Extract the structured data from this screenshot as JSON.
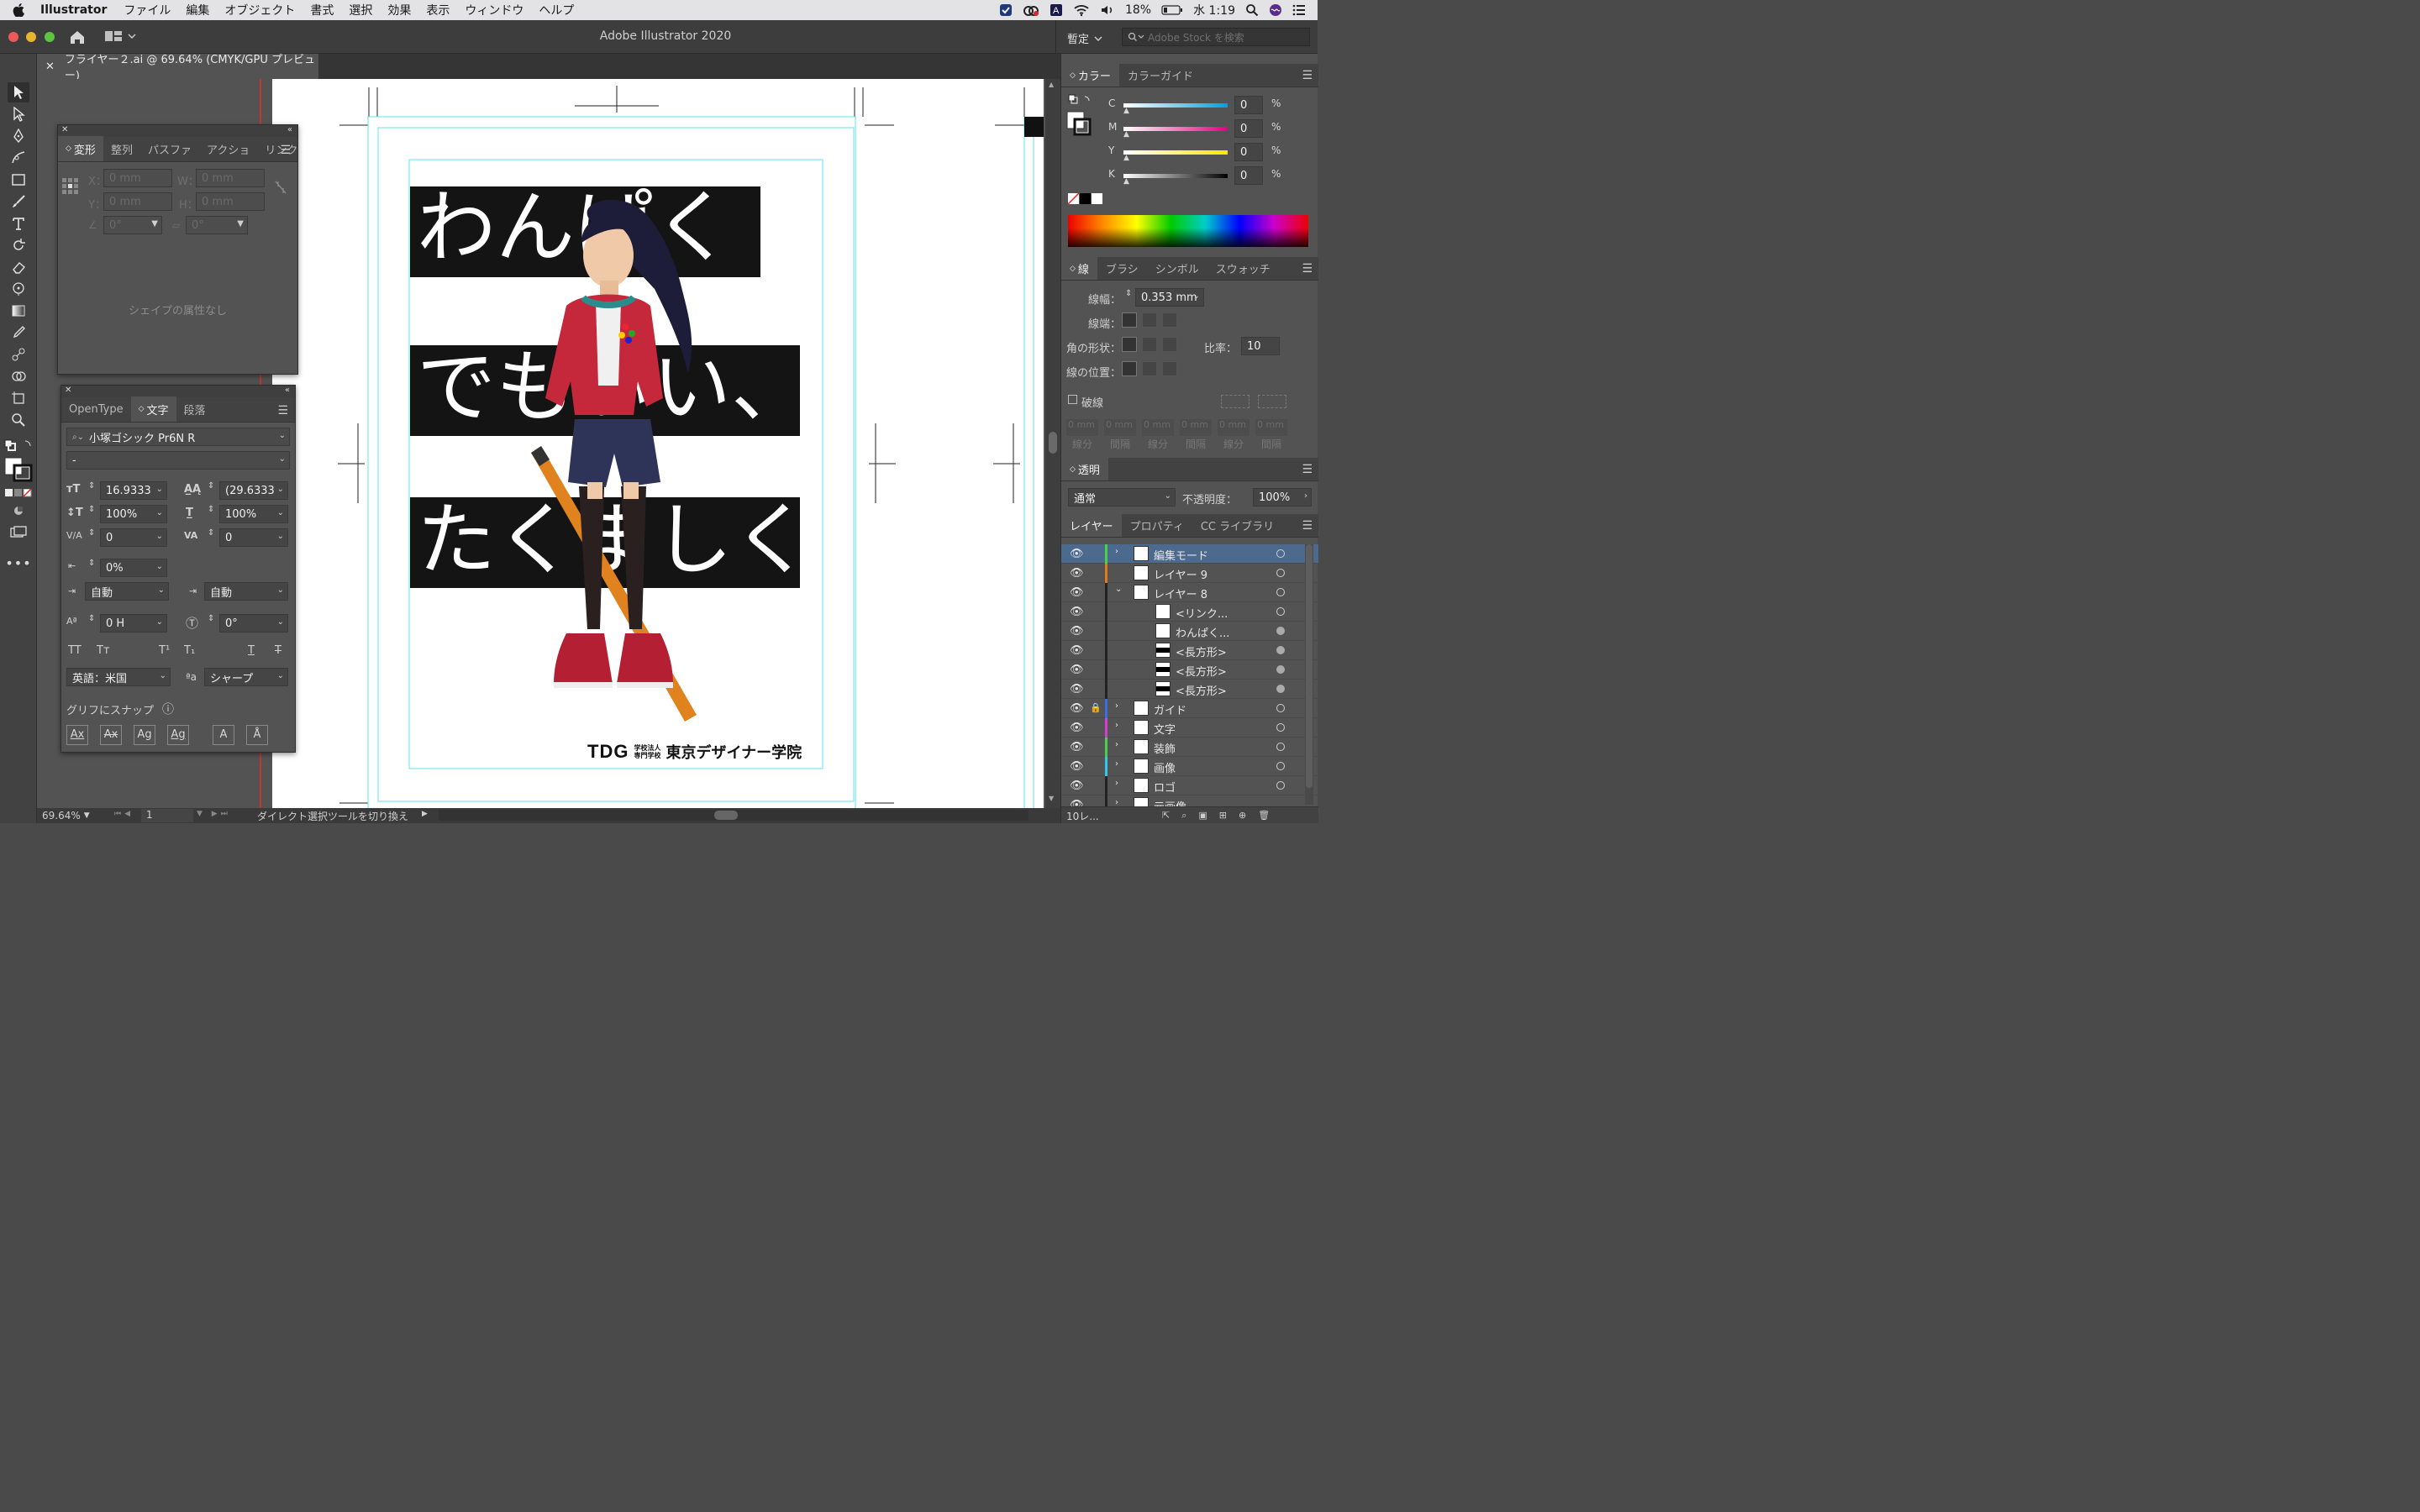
{
  "menubar": {
    "app": "Illustrator",
    "items": [
      "ファイル",
      "編集",
      "オブジェクト",
      "書式",
      "選択",
      "効果",
      "表示",
      "ウィンドウ",
      "ヘルプ"
    ],
    "status": {
      "battery": "18%",
      "time": "水 1:19"
    }
  },
  "titlebar": {
    "title": "Adobe Illustrator 2020",
    "workspace": "暫定",
    "stock_search_placeholder": "Adobe Stock を検索"
  },
  "document_tab": {
    "label": "フライヤー２.ai @ 69.64% (CMYK/GPU プレビュー)"
  },
  "artwork": {
    "lines": [
      "わんぱく",
      "でもいい、",
      "たくましく"
    ],
    "logo_mark": "TDG",
    "logo_small_1": "学校法人",
    "logo_small_2": "専門学校",
    "logo_name": "東京デザイナー学院"
  },
  "transform_panel": {
    "tabs": [
      "変形",
      "整列",
      "パスファ",
      "アクショ",
      "リンク"
    ],
    "x_label": "X：",
    "y_label": "Y：",
    "w_label": "W：",
    "h_label": "H：",
    "x": "0 mm",
    "y": "0 mm",
    "w": "0 mm",
    "h": "0 mm",
    "angle": "0°",
    "shear": "0°",
    "empty_message": "シェイプの属性なし"
  },
  "character_panel": {
    "tabs": [
      "OpenType",
      "文字",
      "段落"
    ],
    "font_family": "小塚ゴシック Pr6N R",
    "font_style": "-",
    "font_size": "16.9333",
    "leading": "(29.6333",
    "vertical_scale": "100%",
    "horizontal_scale": "100%",
    "kerning": "0",
    "tracking": "0",
    "tsume": "0%",
    "aki_left": "自動",
    "aki_right": "自動",
    "baseline_shift": "0 H",
    "rotation": "0°",
    "language": "英語：米国",
    "antialias": "シャープ",
    "glyph_snap_label": "グリフにスナップ"
  },
  "color_panel": {
    "tabs": [
      "カラー",
      "カラーガイド"
    ],
    "channels": [
      {
        "label": "C",
        "value": "0",
        "unit": "%"
      },
      {
        "label": "M",
        "value": "0",
        "unit": "%"
      },
      {
        "label": "Y",
        "value": "0",
        "unit": "%"
      },
      {
        "label": "K",
        "value": "0",
        "unit": "%"
      }
    ]
  },
  "stroke_panel": {
    "tabs": [
      "線",
      "ブラシ",
      "シンボル",
      "スウォッチ"
    ],
    "weight_label": "線幅：",
    "weight": "0.353 mm",
    "cap_label": "線端：",
    "corner_label": "角の形状：",
    "limit_label": "比率：",
    "limit": "10",
    "align_label": "線の位置：",
    "dashed_label": "破線",
    "dash_fields": [
      "0 mm",
      "0 mm",
      "0 mm",
      "0 mm",
      "0 mm",
      "0 mm"
    ],
    "dash_labels": [
      "線分",
      "間隔",
      "線分",
      "間隔",
      "線分",
      "間隔"
    ]
  },
  "transparency_panel": {
    "title": "透明",
    "blend_mode": "通常",
    "opacity_label": "不透明度：",
    "opacity": "100%"
  },
  "layers_panel": {
    "tabs": [
      "レイヤー",
      "プロパティ",
      "CC ライブラリ"
    ],
    "rows": [
      {
        "name": "編集モード",
        "color": "#4ad14a"
      },
      {
        "name": "レイヤー 9",
        "color": "#e07a1f"
      },
      {
        "name": "レイヤー 8",
        "color": "#222222"
      },
      {
        "name": "<リンク...",
        "color": "#222222"
      },
      {
        "name": "わんぱく...",
        "color": "#222222"
      },
      {
        "name": "<長方形>",
        "color": "#222222"
      },
      {
        "name": "<長方形>",
        "color": "#222222"
      },
      {
        "name": "<長方形>",
        "color": "#222222"
      },
      {
        "name": "ガイド",
        "color": "#3d6ee0"
      },
      {
        "name": "文字",
        "color": "#d23fd2"
      },
      {
        "name": "装飾",
        "color": "#4ad14a"
      },
      {
        "name": "画像",
        "color": "#33c8e8"
      },
      {
        "name": "ロゴ",
        "color": "#222222"
      },
      {
        "name": "元画像",
        "color": "#222222"
      }
    ],
    "count": "10レ..."
  },
  "statusbar": {
    "zoom": "69.64%",
    "page": "1",
    "message": "ダイレクト選択ツールを切り換え"
  },
  "colors": {
    "guide": "#5fe3ea",
    "selected_layer": "#4b6a8e",
    "accent_red": "#c0392b"
  }
}
